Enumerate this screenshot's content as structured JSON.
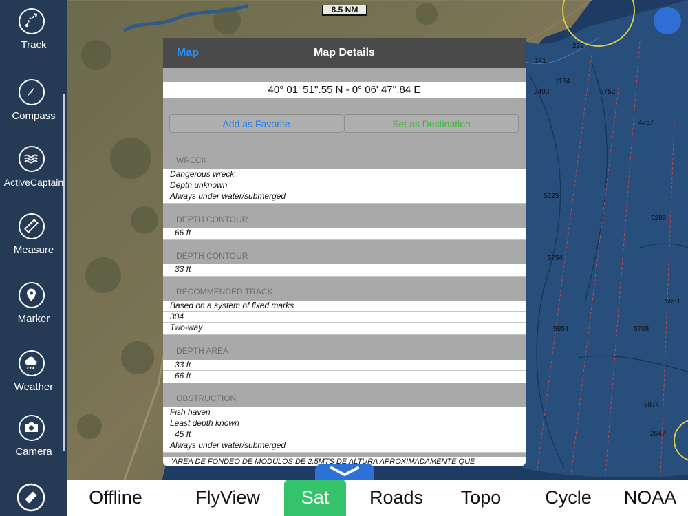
{
  "sidebar": {
    "items": [
      {
        "label": "Track",
        "icon": "track-icon"
      },
      {
        "label": "Compass",
        "icon": "compass-icon"
      },
      {
        "label": "ActiveCaptain",
        "icon": "activecaptain-icon"
      },
      {
        "label": "Measure",
        "icon": "ruler-icon"
      },
      {
        "label": "Marker",
        "icon": "marker-icon"
      },
      {
        "label": "Weather",
        "icon": "weather-icon"
      },
      {
        "label": "Camera",
        "icon": "camera-icon"
      }
    ],
    "bottom_icon": "satellite-icon"
  },
  "map": {
    "scale_label": "8.5 NM",
    "depths": [
      "229",
      "141",
      "2490",
      "1164",
      "2752",
      "4757",
      "5223",
      "5288",
      "5754",
      "5951",
      "5954",
      "5708",
      "3874",
      "2647"
    ]
  },
  "panel": {
    "back_label": "Map",
    "title": "Map Details",
    "coordinates": "40° 01' 51''.55 N  -  0° 06' 47''.84 E",
    "add_favorite": "Add as Favorite",
    "set_destination": "Set as Destination",
    "sections": [
      {
        "heading": "WRECK",
        "rows": [
          "Dangerous wreck",
          "Depth unknown",
          "Always under water/submerged"
        ]
      },
      {
        "heading": "DEPTH CONTOUR",
        "rows": [
          "66 ft"
        ]
      },
      {
        "heading": "DEPTH CONTOUR",
        "rows": [
          "33 ft"
        ]
      },
      {
        "heading": "RECOMMENDED TRACK",
        "rows": [
          "Based on a system of fixed marks",
          "304",
          "Two-way"
        ]
      },
      {
        "heading": "DEPTH AREA",
        "rows": [
          "33 ft",
          "66 ft"
        ]
      },
      {
        "heading": "OBSTRUCTION",
        "rows": [
          "Fish haven",
          "Least depth known",
          "45 ft",
          "Always under water/submerged"
        ]
      }
    ],
    "footer_text": "\"AREA DE FONDEO DE MODULOS DE 2.5MTS DE ALTURA APROXIMADAMENTE QUE"
  },
  "tabbar": {
    "tabs": [
      "Offline",
      "FlyView",
      "Sat",
      "Roads",
      "Topo",
      "Cycle",
      "NOAA"
    ],
    "active": "Sat"
  },
  "colors": {
    "accent": "#2d8cf0",
    "active_tab": "#34c36a",
    "destination": "#3fb63f",
    "sidebar": "#243a55"
  }
}
